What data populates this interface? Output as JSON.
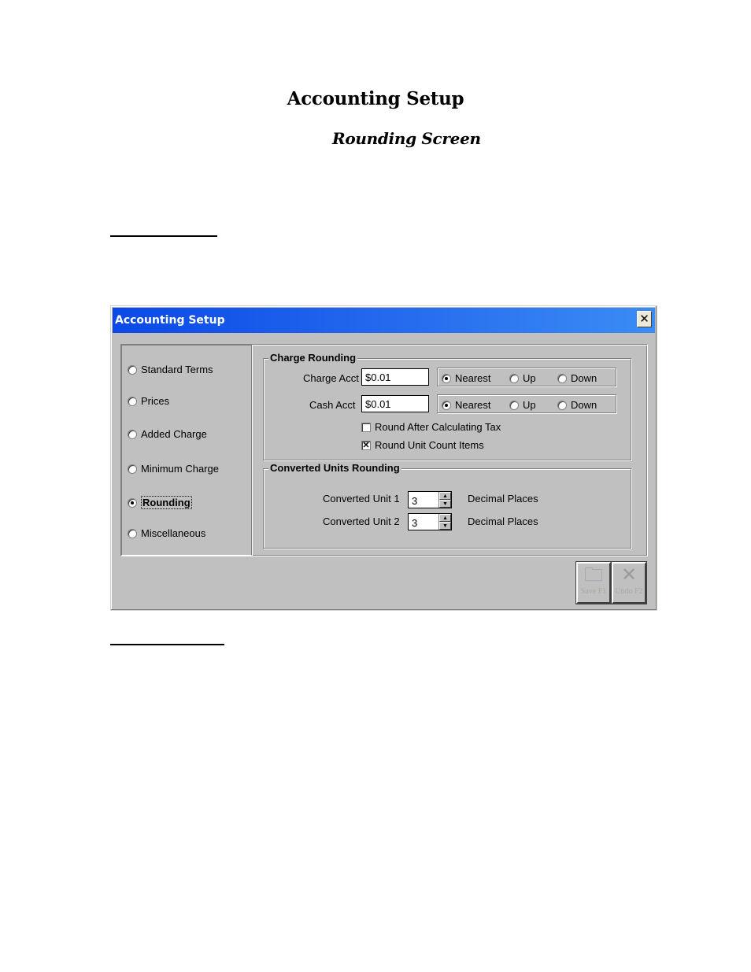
{
  "document": {
    "title": "Accounting Setup",
    "subtitle": "Rounding Screen"
  },
  "window": {
    "title": "Accounting Setup",
    "close_icon": "✕",
    "nav": [
      {
        "label": "Standard Terms",
        "selected": false
      },
      {
        "label": "Prices",
        "selected": false
      },
      {
        "label": "Added Charge",
        "selected": false
      },
      {
        "label": "Minimum Charge",
        "selected": false
      },
      {
        "label": "Rounding",
        "selected": true
      },
      {
        "label": "Miscellaneous",
        "selected": false
      }
    ],
    "charge_rounding": {
      "group_label": "Charge Rounding",
      "charge_acct_label": "Charge Acct",
      "charge_acct_value": "$0.01",
      "cash_acct_label": "Cash Acct",
      "cash_acct_value": "$0.01",
      "options": [
        "Nearest",
        "Up",
        "Down"
      ],
      "charge_acct_selected": "Nearest",
      "cash_acct_selected": "Nearest",
      "round_after_tax_label": "Round After Calculating Tax",
      "round_after_tax_checked": false,
      "round_unit_count_label": "Round Unit Count Items",
      "round_unit_count_checked": true,
      "check_mark": "✕"
    },
    "converted_units": {
      "group_label": "Converted Units Rounding",
      "unit1_label": "Converted Unit 1",
      "unit1_value": "3",
      "unit2_label": "Converted Unit 2",
      "unit2_value": "3",
      "suffix": "Decimal Places"
    },
    "toolbar": {
      "save_label": "Save F1",
      "undo_label": "Undo F2",
      "save_icon": "🗀",
      "undo_icon": "✕"
    }
  }
}
